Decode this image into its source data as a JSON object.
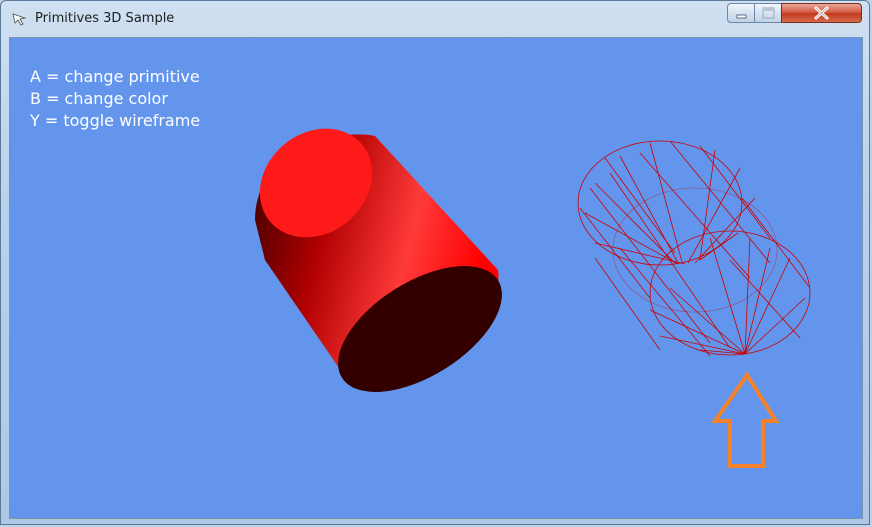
{
  "window": {
    "title": "Primitives 3D Sample",
    "app_icon": "pointer-app-icon",
    "controls": [
      "minimize-icon",
      "maximize-icon",
      "close-icon"
    ]
  },
  "viewport": {
    "background_color": "#6495ed",
    "instructions": [
      "A = change primitive",
      "B = change color",
      "Y = toggle wireframe"
    ],
    "primitive": "cylinder",
    "primitive_color": "#ff0000",
    "wireframe_color": "#cc0000",
    "annotation_arrow_color": "#f5822a"
  }
}
